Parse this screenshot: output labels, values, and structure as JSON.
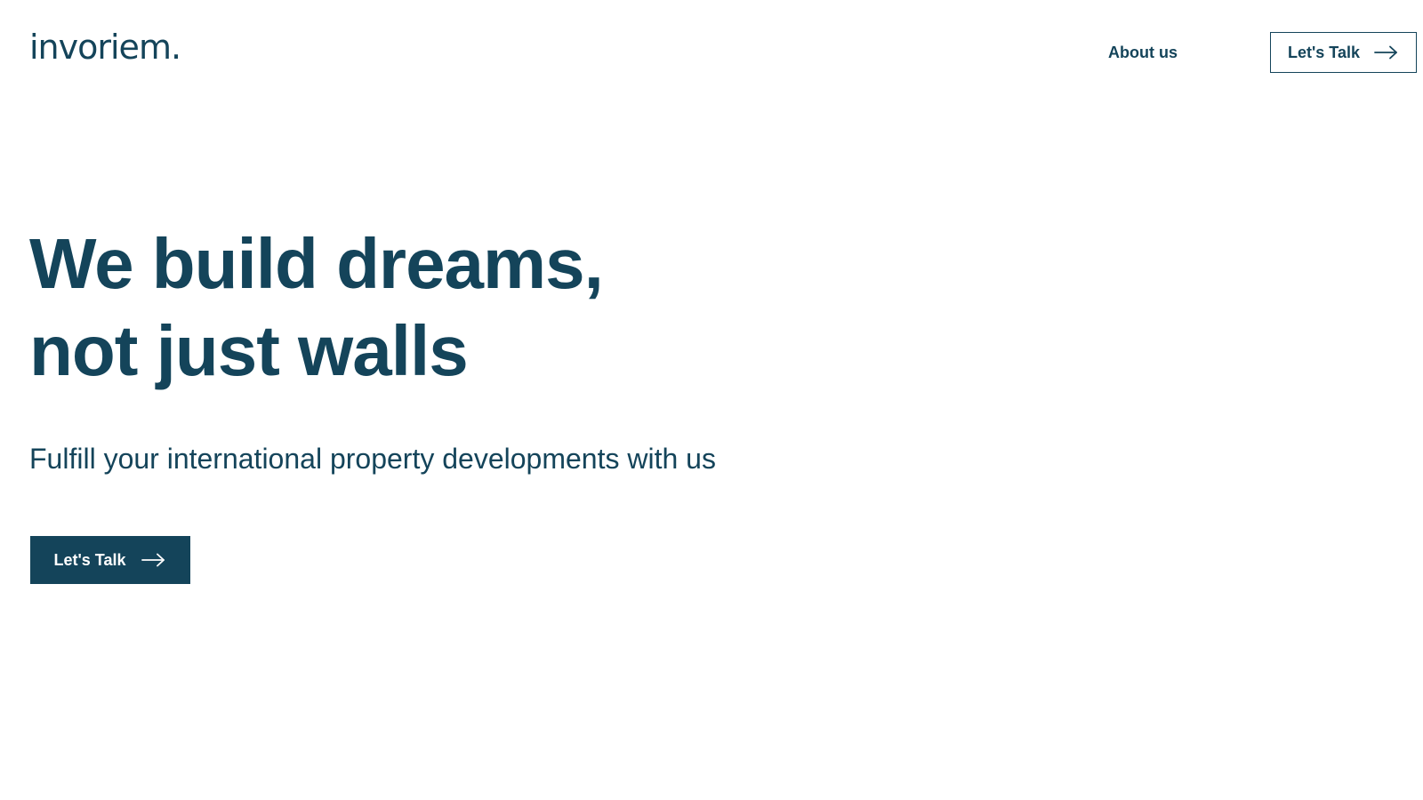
{
  "header": {
    "logo_text": "invoriem.",
    "nav": {
      "about_label": "About us"
    },
    "cta_label": "Let's Talk",
    "cta_icon": "arrow-right-icon"
  },
  "hero": {
    "title_line1": "We build dreams,",
    "title_line2": "not just walls",
    "subtitle": "Fulfill your international property developments with us",
    "cta_label": "Let's Talk",
    "cta_icon": "arrow-right-icon"
  },
  "colors": {
    "brand": "#14445a",
    "background": "#ffffff",
    "button_text": "#ffffff"
  }
}
